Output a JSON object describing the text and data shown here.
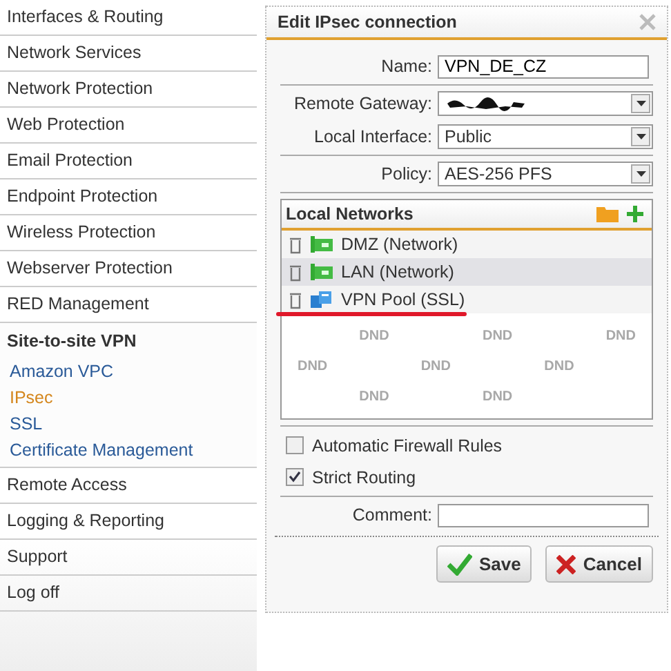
{
  "sidebar": {
    "items": [
      {
        "label": "Interfaces & Routing",
        "kind": "item",
        "selected": false
      },
      {
        "label": "Network Services",
        "kind": "item",
        "selected": false
      },
      {
        "label": "Network Protection",
        "kind": "item",
        "selected": false
      },
      {
        "label": "Web Protection",
        "kind": "item",
        "selected": false
      },
      {
        "label": "Email Protection",
        "kind": "item",
        "selected": false
      },
      {
        "label": "Endpoint Protection",
        "kind": "item",
        "selected": false
      },
      {
        "label": "Wireless Protection",
        "kind": "item",
        "selected": false
      },
      {
        "label": "Webserver Protection",
        "kind": "item",
        "selected": false
      },
      {
        "label": "RED Management",
        "kind": "item",
        "selected": false
      },
      {
        "label": "Site-to-site VPN",
        "kind": "section",
        "selected": false,
        "children": [
          {
            "label": "Amazon VPC",
            "selected": false
          },
          {
            "label": "IPsec",
            "selected": true
          },
          {
            "label": "SSL",
            "selected": false
          },
          {
            "label": "Certificate Management",
            "selected": false
          }
        ]
      },
      {
        "label": "Remote Access",
        "kind": "item",
        "selected": false
      },
      {
        "label": "Logging & Reporting",
        "kind": "item",
        "selected": false
      },
      {
        "label": "Support",
        "kind": "item",
        "selected": false
      },
      {
        "label": "Log off",
        "kind": "item",
        "selected": false
      }
    ]
  },
  "dialog": {
    "title": "Edit IPsec connection",
    "name": {
      "label": "Name:",
      "value": "VPN_DE_CZ"
    },
    "remote_gateway": {
      "label": "Remote Gateway:",
      "redacted": true
    },
    "local_interface": {
      "label": "Local Interface:",
      "value": "Public"
    },
    "policy": {
      "label": "Policy:",
      "value": "AES-256 PFS"
    },
    "local_networks": {
      "title": "Local Networks",
      "items": [
        {
          "label": "DMZ (Network)",
          "kind": "network",
          "annotated": false
        },
        {
          "label": "LAN (Network)",
          "kind": "network",
          "annotated": false
        },
        {
          "label": "VPN Pool (SSL)",
          "kind": "pool",
          "annotated": true
        }
      ],
      "drop_zone_labels": [
        "DND",
        "DND",
        "DND",
        "DND",
        "DND",
        "DND",
        "DND",
        "DND"
      ]
    },
    "options": [
      {
        "label": "Automatic Firewall Rules",
        "checked": false
      },
      {
        "label": "Strict Routing",
        "checked": true
      }
    ],
    "comment": {
      "label": "Comment:"
    },
    "buttons": [
      {
        "label": "Save",
        "kind": "save"
      },
      {
        "label": "Cancel",
        "kind": "cancel"
      }
    ]
  }
}
